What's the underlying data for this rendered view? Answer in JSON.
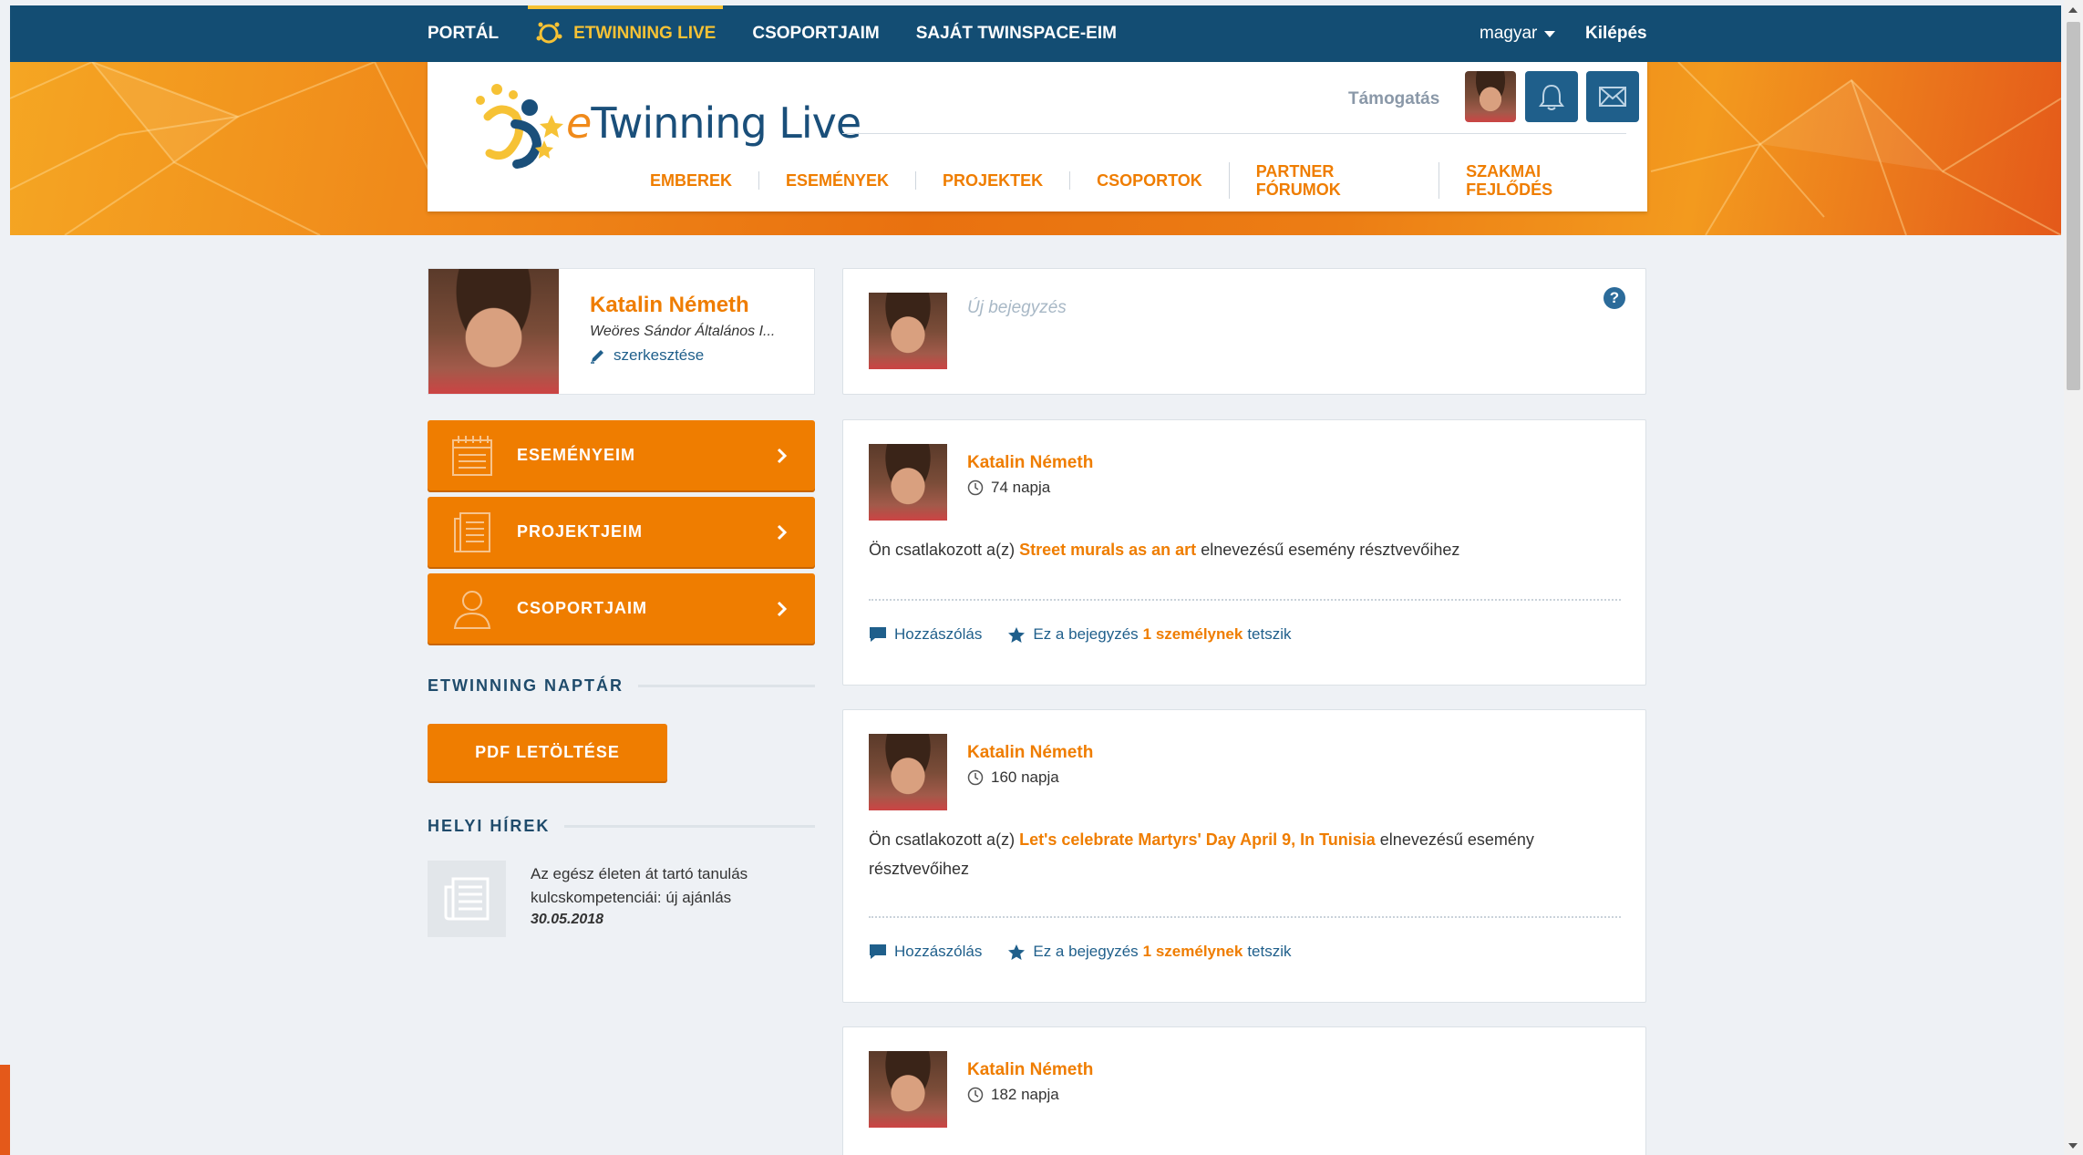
{
  "topnav": {
    "items": [
      "PORTÁL",
      "ETWINNING LIVE",
      "CSOPORTJAIM",
      "SAJÁT TWINSPACE-EIM"
    ],
    "active": "ETWINNING LIVE",
    "language": "magyar",
    "logout": "Kilépés"
  },
  "header": {
    "logo_e": "e",
    "logo_rest": "Twinning Live",
    "support": "Támogatás",
    "nav": [
      "EMBEREK",
      "ESEMÉNYEK",
      "PROJEKTEK",
      "CSOPORTOK",
      "PARTNER FÓRUMOK",
      "SZAKMAI FEJLŐDÉS"
    ],
    "icons": [
      "bell-icon",
      "mail-icon"
    ]
  },
  "profile": {
    "name": "Katalin Németh",
    "school": "Weöres Sándor Általános I...",
    "edit": "szerkesztése"
  },
  "sidebar": {
    "buttons": [
      {
        "label": "ESEMÉNYEIM",
        "icon": "calendar-icon"
      },
      {
        "label": "PROJEKTJEIM",
        "icon": "document-icon"
      },
      {
        "label": "CSOPORTJAIM",
        "icon": "user-icon"
      }
    ],
    "calendar_title": "ETWINNING NAPTÁR",
    "pdf_button": "PDF LETÖLTÉSE",
    "news_title": "HELYI HÍREK",
    "news": {
      "text": "Az egész életen át tartó tanulás kulcskompetenciái: új ajánlás",
      "date": "30.05.2018"
    }
  },
  "new_post": {
    "placeholder": "Új bejegyzés",
    "help": "?"
  },
  "posts": [
    {
      "author": "Katalin Németh",
      "time": "74 napja",
      "prefix": "Ön csatlakozott a(z)",
      "event": "Street murals as an art",
      "suffix": "elnevezésű esemény résztvevőihez",
      "comment": "Hozzászólás",
      "like_prefix": "Ez a bejegyzés",
      "like_count": "1 személynek",
      "like_suffix": "tetszik"
    },
    {
      "author": "Katalin Németh",
      "time": "160 napja",
      "prefix": "Ön csatlakozott a(z)",
      "event": "Let's celebrate Martyrs' Day April 9, In Tunisia",
      "suffix": "elnevezésű esemény résztvevőihez",
      "comment": "Hozzászólás",
      "like_prefix": "Ez a bejegyzés",
      "like_count": "1 személynek",
      "like_suffix": "tetszik"
    },
    {
      "author": "Katalin Németh",
      "time": "182 napja"
    }
  ],
  "colors": {
    "topbar": "#134d73",
    "accent": "#ef7d00",
    "active_nav": "#f6c235",
    "link": "#1f5f8b"
  }
}
